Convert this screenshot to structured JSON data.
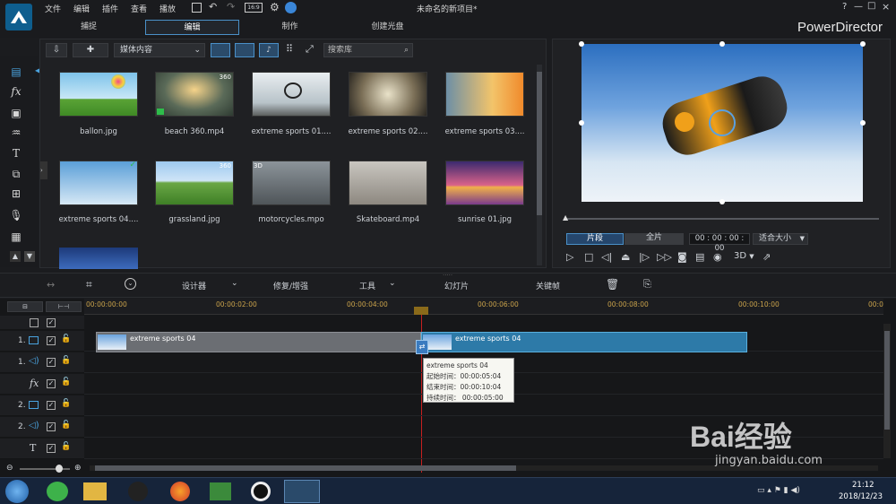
{
  "app": {
    "name": "PowerDirector",
    "window_title": "未命名的新项目*",
    "menu": [
      "文件",
      "编辑",
      "插件",
      "查看",
      "播放"
    ],
    "mode_tabs": [
      "捕捉",
      "编辑",
      "制作",
      "创建光盘"
    ],
    "active_tab": "编辑",
    "window_controls": [
      "?",
      "—",
      "□",
      "×"
    ]
  },
  "media_panel": {
    "dropdown": "媒体内容",
    "search_placeholder": "搜索库",
    "items": [
      {
        "name": "ballon.jpg"
      },
      {
        "name": "beach 360.mp4",
        "badge": "360"
      },
      {
        "name": "extreme sports 01...."
      },
      {
        "name": "extreme sports 02...."
      },
      {
        "name": "extreme sports 03...."
      },
      {
        "name": "extreme sports 04....",
        "badge": "✓"
      },
      {
        "name": "grassland.jpg",
        "badge": "360"
      },
      {
        "name": "motorcycles.mpo",
        "badge": "3D"
      },
      {
        "name": "Skateboard.mp4"
      },
      {
        "name": "sunrise 01.jpg"
      }
    ]
  },
  "preview": {
    "mode_clip": "片段",
    "mode_full": "全片",
    "timecode": "00 : 00 : 00 : 00",
    "fit_label": "适合大小",
    "mode_3d": "3D"
  },
  "edit_toolbar": {
    "designer": "设计器",
    "fix_enhance": "修复/增强",
    "tools": "工具",
    "slideshow": "幻灯片",
    "keyframe": "关键帧"
  },
  "timeline": {
    "ticks": [
      "00:00:00:00",
      "00:00:02:00",
      "00:00:04:00",
      "00:00:06:00",
      "00:00:08:00",
      "00:00:10:00",
      "00:0"
    ],
    "tracks": [
      {
        "label": "1.",
        "type": "video"
      },
      {
        "label": "1.",
        "type": "audio"
      },
      {
        "label": "fx",
        "type": "fx"
      },
      {
        "label": "2.",
        "type": "video"
      },
      {
        "label": "2.",
        "type": "audio"
      },
      {
        "label": "T",
        "type": "title"
      }
    ],
    "clips": [
      {
        "title": "extreme sports 04"
      },
      {
        "title": "extreme sports 04"
      }
    ],
    "tooltip": {
      "title": "extreme sports 04",
      "start": "起始时间：00:00:05:04",
      "end": "结束时间：00:00:10:04",
      "duration": "持续时间：  00:00:05:00"
    }
  },
  "taskbar": {
    "time": "21:12",
    "date": "2018/12/23"
  },
  "watermark": {
    "text": "Bai经验",
    "url": "jingyan.baidu.com"
  }
}
